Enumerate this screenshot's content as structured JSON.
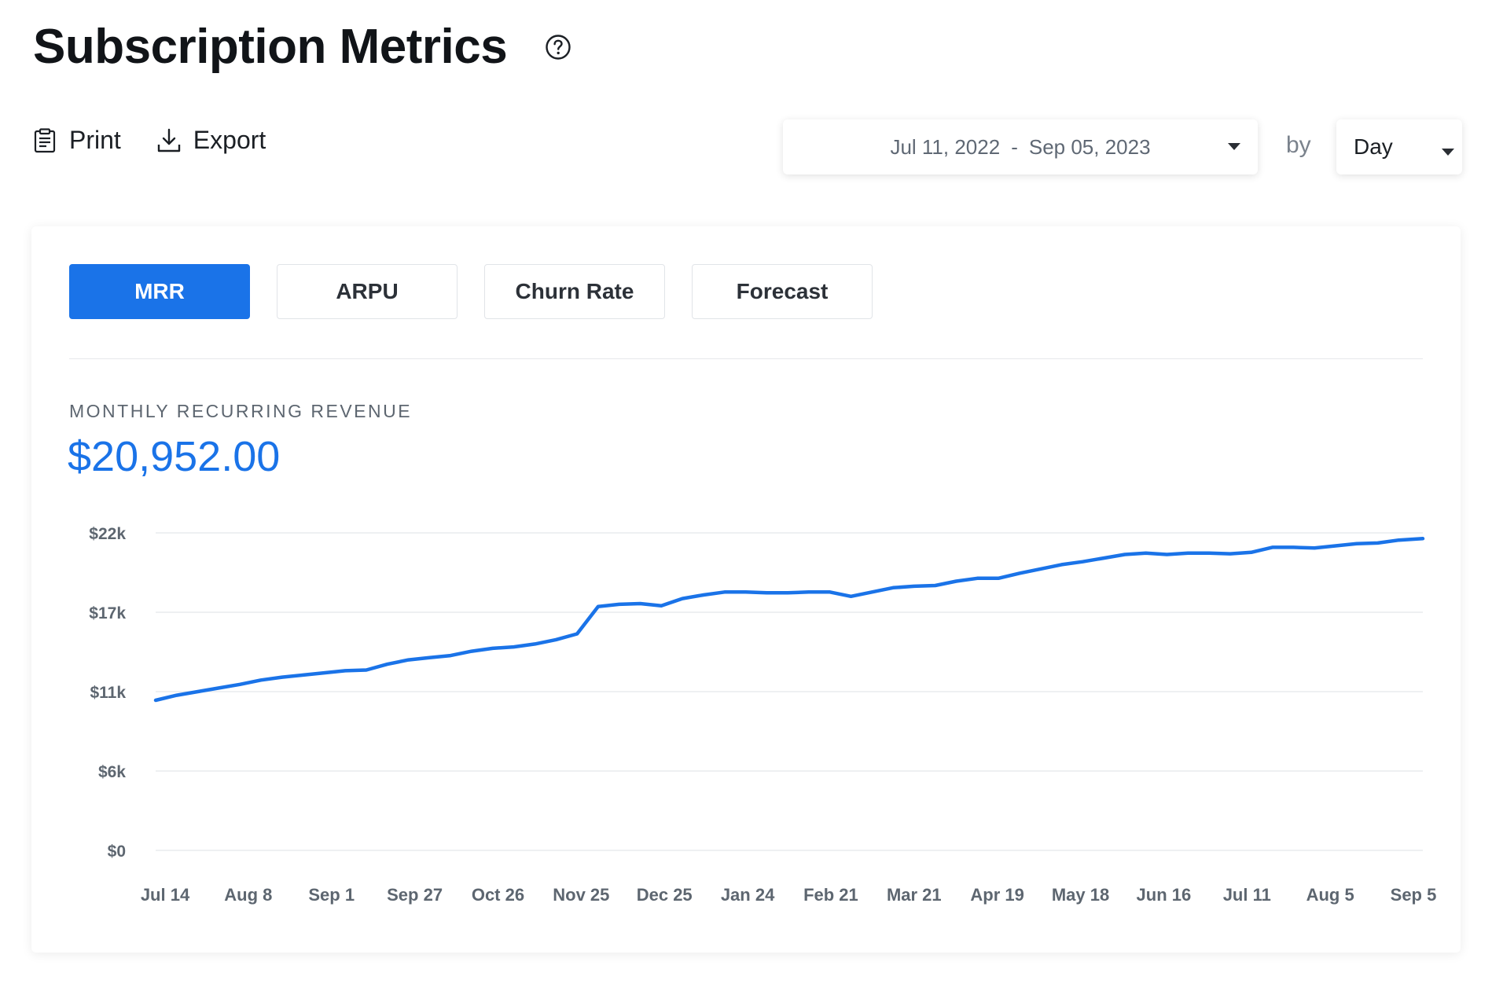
{
  "header": {
    "title": "Subscription Metrics",
    "help_icon": "question-circle-icon"
  },
  "toolbar": {
    "print_label": "Print",
    "export_label": "Export"
  },
  "date_range": {
    "start": "Jul 11, 2022",
    "separator": "-",
    "end": "Sep 05, 2023"
  },
  "granularity": {
    "by_label": "by",
    "value": "Day"
  },
  "tabs": [
    {
      "label": "MRR",
      "active": true
    },
    {
      "label": "ARPU",
      "active": false
    },
    {
      "label": "Churn Rate",
      "active": false
    },
    {
      "label": "Forecast",
      "active": false
    }
  ],
  "metric": {
    "label": "MONTHLY RECURRING REVENUE",
    "value": "$20,952.00"
  },
  "colors": {
    "accent": "#1a73e8",
    "grid": "#e9ebee",
    "tick_text": "#5d6670"
  },
  "chart_data": {
    "type": "line",
    "title": "",
    "xlabel": "",
    "ylabel": "",
    "ylim": [
      0,
      22000
    ],
    "yticks": [
      0,
      5500,
      11000,
      16500,
      22000
    ],
    "ytick_labels": [
      "$0",
      "$6k",
      "$11k",
      "$17k",
      "$22k"
    ],
    "xtick_labels": [
      "Jul 14",
      "Aug 8",
      "Sep 1",
      "Sep 27",
      "Oct 26",
      "Nov 25",
      "Dec 25",
      "Jan 24",
      "Feb 21",
      "Mar 21",
      "Apr 19",
      "May 18",
      "Jun 16",
      "Jul 11",
      "Aug 5",
      "Sep 5"
    ],
    "grid": true,
    "legend": "none",
    "series": [
      {
        "color": "#1a73e8",
        "x": [
          "2022-07-11",
          "2022-07-18",
          "2022-07-25",
          "2022-08-01",
          "2022-08-08",
          "2022-08-15",
          "2022-08-22",
          "2022-08-29",
          "2022-09-05",
          "2022-09-12",
          "2022-09-19",
          "2022-09-26",
          "2022-10-03",
          "2022-10-10",
          "2022-10-17",
          "2022-10-24",
          "2022-10-31",
          "2022-11-07",
          "2022-11-14",
          "2022-11-21",
          "2022-11-28",
          "2022-12-05",
          "2022-12-12",
          "2022-12-19",
          "2022-12-26",
          "2023-01-02",
          "2023-01-09",
          "2023-01-16",
          "2023-01-23",
          "2023-01-30",
          "2023-02-06",
          "2023-02-13",
          "2023-02-20",
          "2023-02-27",
          "2023-03-06",
          "2023-03-13",
          "2023-03-20",
          "2023-03-27",
          "2023-04-03",
          "2023-04-10",
          "2023-04-17",
          "2023-04-24",
          "2023-05-01",
          "2023-05-08",
          "2023-05-15",
          "2023-05-22",
          "2023-05-29",
          "2023-06-05",
          "2023-06-12",
          "2023-06-19",
          "2023-06-26",
          "2023-07-03",
          "2023-07-10",
          "2023-07-17",
          "2023-07-24",
          "2023-07-31",
          "2023-08-07",
          "2023-08-14",
          "2023-08-21",
          "2023-08-28",
          "2023-09-05"
        ],
        "y": [
          10400,
          10750,
          11000,
          11250,
          11500,
          11800,
          12000,
          12150,
          12300,
          12450,
          12500,
          12900,
          13200,
          13350,
          13500,
          13800,
          14000,
          14100,
          14300,
          14600,
          15000,
          16900,
          17050,
          17100,
          16950,
          17450,
          17700,
          17900,
          17900,
          17850,
          17850,
          17900,
          17900,
          17600,
          17900,
          18200,
          18300,
          18350,
          18650,
          18850,
          18850,
          19200,
          19500,
          19800,
          20000,
          20250,
          20500,
          20600,
          20500,
          20600,
          20600,
          20550,
          20650,
          21000,
          21000,
          20950,
          21100,
          21250,
          21300,
          21500,
          21600
        ]
      }
    ]
  }
}
